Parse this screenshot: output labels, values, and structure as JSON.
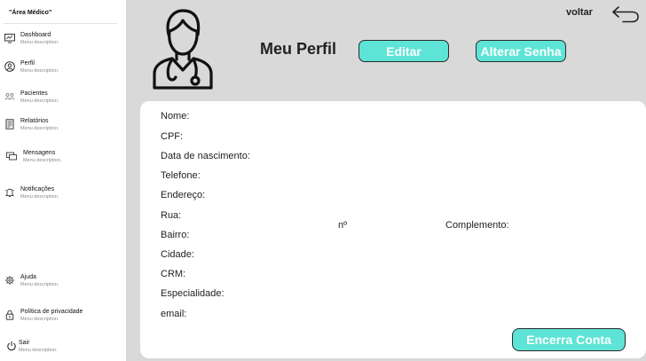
{
  "sidebar": {
    "brand": "\"Área Médico\"",
    "items": [
      {
        "label": "Dashboard",
        "desc": "Menu description.",
        "icon": "dashboard-icon"
      },
      {
        "label": "Perfil",
        "desc": "Menu description.",
        "icon": "user-icon"
      },
      {
        "label": "Pacientes",
        "desc": "Menu description.",
        "icon": "patients-icon"
      },
      {
        "label": "Relatórios",
        "desc": "Menu description.",
        "icon": "report-icon"
      },
      {
        "label": "Mensagens",
        "desc": "Menu description.",
        "icon": "messages-icon"
      },
      {
        "label": "Notificações",
        "desc": "Menu description.",
        "icon": "bell-icon"
      },
      {
        "label": "Ajuda",
        "desc": "Menu description.",
        "icon": "help-icon"
      },
      {
        "label": "Política de privacidade",
        "desc": "Menu description.",
        "icon": "lock-icon"
      },
      {
        "label": "Sair",
        "desc": "Menu description.",
        "icon": "power-icon"
      }
    ]
  },
  "header": {
    "title": "Meu Perfil",
    "edit_label": "Editar",
    "change_password_label": "Alterar Senha",
    "back_label": "voltar"
  },
  "profile": {
    "fields": [
      "Nome:",
      "CPF:",
      "Data de nascimento:",
      "Telefone:",
      "Endereço:",
      "Rua:",
      "Bairro:",
      "Cidade:",
      "CRM:",
      "Especialidade:",
      "email:"
    ],
    "number_label": "nº",
    "complement_label": "Complemento:",
    "close_account_label": "Encerra Conta"
  },
  "colors": {
    "accent": "#5ee4d6",
    "background": "#d9d9d9"
  }
}
